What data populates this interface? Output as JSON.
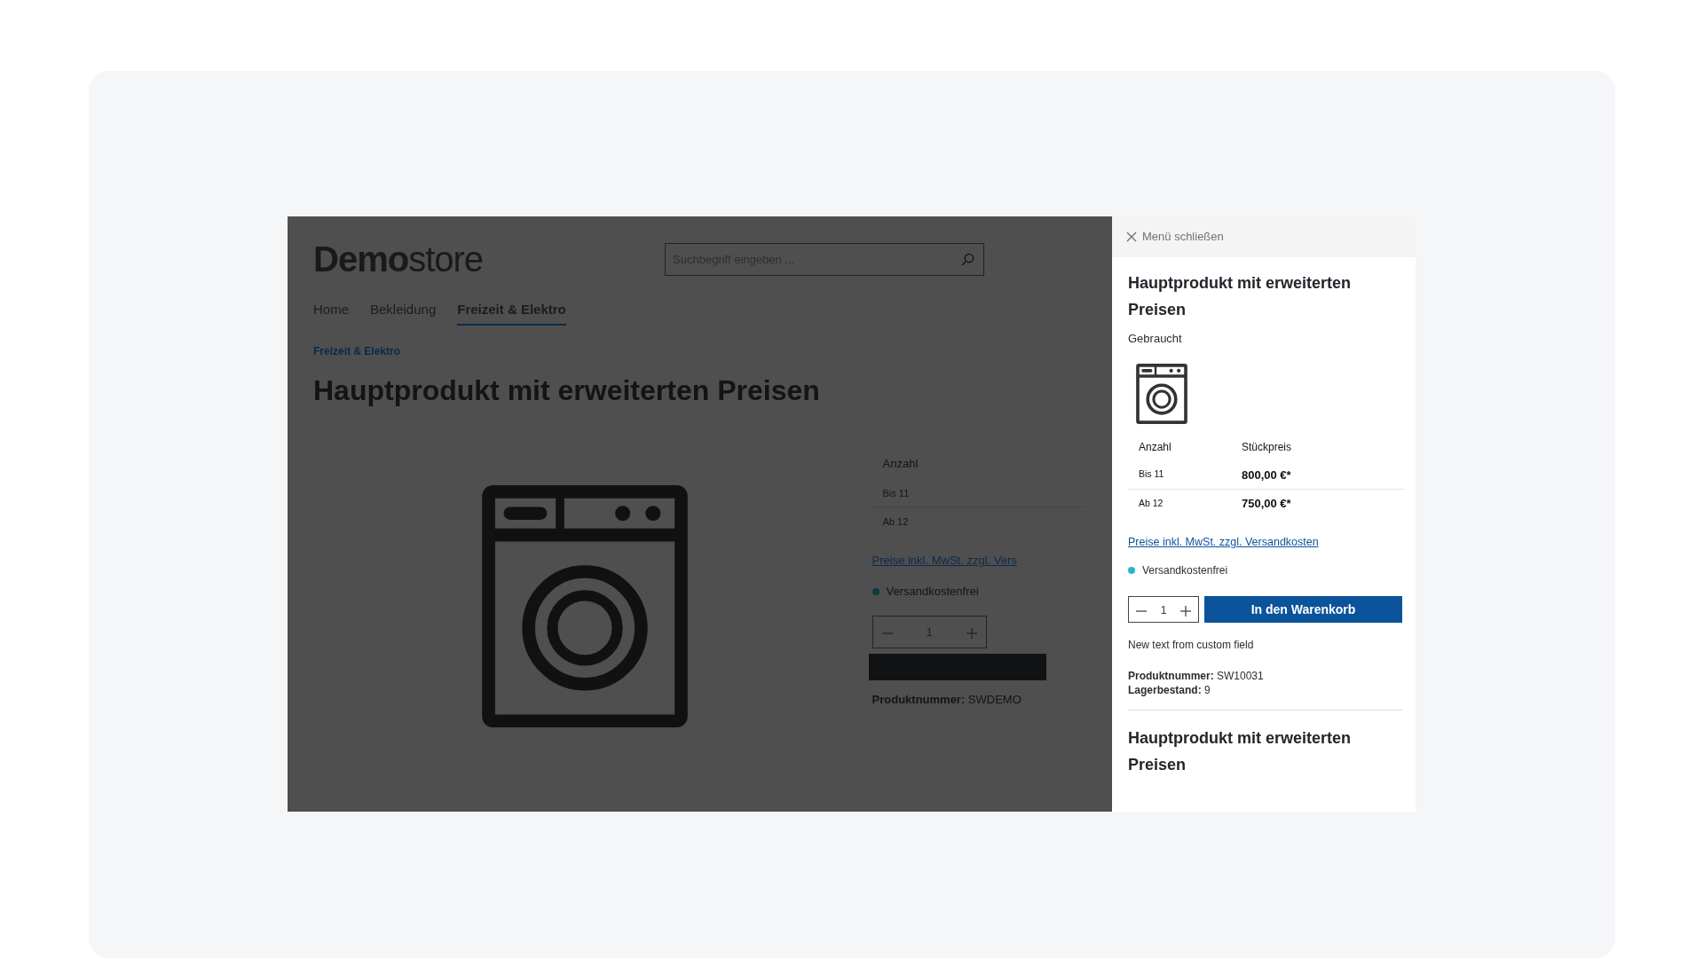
{
  "page": {
    "logo": "**Demo**store",
    "search": {
      "placeholder": "Suchbegriff eingeben ..."
    },
    "nav": [
      {
        "label": "Home",
        "selected": false
      },
      {
        "label": "Bekleidung",
        "selected": false
      },
      {
        "label": "Freizeit & Elektro",
        "selected": true
      }
    ],
    "breadcrumb": "Freizeit & Elektro",
    "title": "Hauptprodukt mit erweiterten Preisen",
    "price_table": {
      "columns": [
        "Anzahl"
      ],
      "rows": [
        [
          "Bis 11"
        ],
        [
          "Ab 12"
        ]
      ]
    },
    "tax_link": "Preise inkl. MwSt. zzgl. Vers",
    "delivery": "Versandkostenfrei",
    "quantity": "1",
    "product_number": {
      "label": "Produktnummer:",
      "value": "SWDEMO"
    }
  },
  "panel": {
    "close": "Menü schließen",
    "title": "Hauptprodukt mit erweiterten Preisen",
    "condition": "Gebraucht",
    "price_table": {
      "columns": [
        "Anzahl",
        "Stückpreis"
      ],
      "rows": [
        [
          "Bis 11",
          "800,00 €*"
        ],
        [
          "Ab 12",
          "750,00 €*"
        ]
      ]
    },
    "tax_link": "Preise inkl. MwSt. zzgl. Versandkosten",
    "delivery": "Versandkostenfrei",
    "quantity": "1",
    "buy_button": "In den Warenkorb",
    "custom_text": "New text from custom field",
    "details": [
      {
        "label": "Produktnummer:",
        "value": "SW10031"
      },
      {
        "label": "Lagerbestand:",
        "value": "9"
      }
    ],
    "next_title": "Hauptprodukt mit erweiterten Preisen"
  }
}
